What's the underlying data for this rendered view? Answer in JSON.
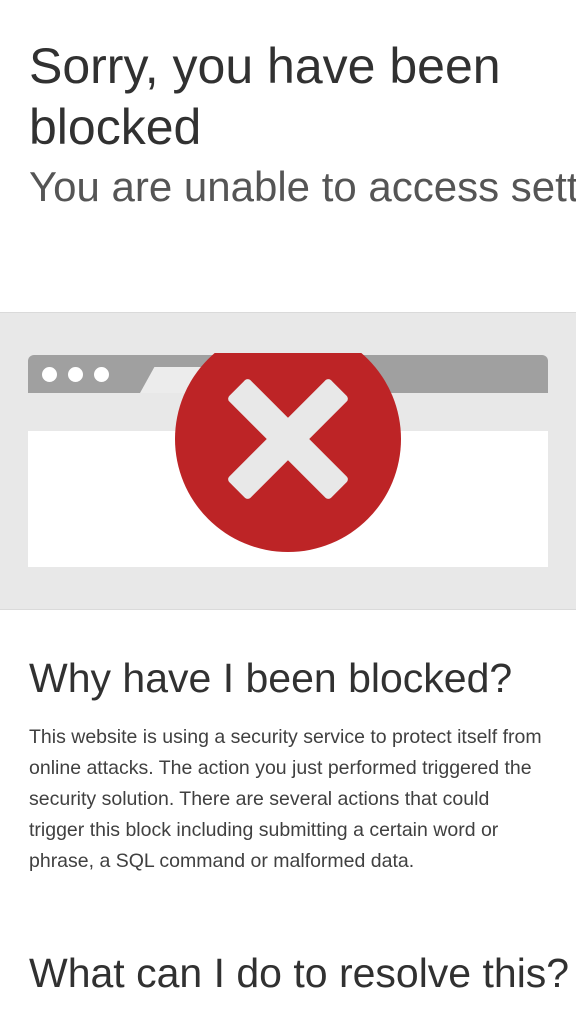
{
  "header": {
    "title": "Sorry, you have been blocked",
    "subtitle": "You are unable to access settings.thegameprovider.com"
  },
  "illustration": {
    "icon": "blocked-x-icon",
    "colors": {
      "circle": "#bd2426",
      "browser_bar": "#a0a0a0",
      "band": "#e8e8e8"
    }
  },
  "why_blocked": {
    "heading": "Why have I been blocked?",
    "body": "This website is using a security service to protect itself from online attacks. The action you just performed triggered the security solution. There are several actions that could trigger this block including submitting a certain word or phrase, a SQL command or malformed data."
  },
  "resolve": {
    "heading": "What can I do to resolve this?"
  }
}
